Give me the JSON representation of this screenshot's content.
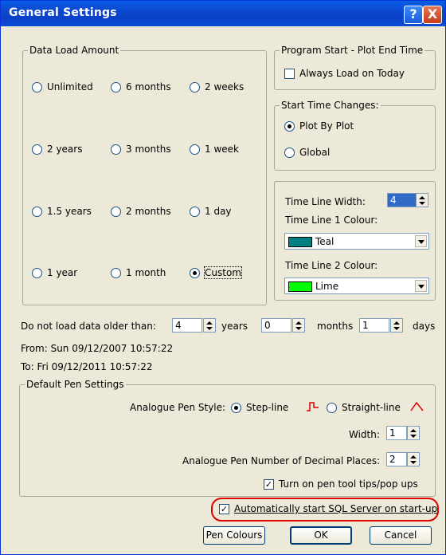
{
  "window": {
    "title": "General Settings",
    "help_label": "?",
    "close_label": "X"
  },
  "data_load": {
    "title": "Data Load Amount",
    "options": [
      "Unlimited",
      "6 months",
      "2 weeks",
      "2 years",
      "3 months",
      "1 week",
      "1.5 years",
      "2 months",
      "1 day",
      "1 year",
      "1 month",
      "Custom"
    ],
    "selected": "Custom"
  },
  "program_start": {
    "title": "Program Start - Plot End Time",
    "always_load_label": "Always Load on Today",
    "always_load_checked": false
  },
  "start_time": {
    "title": "Start Time Changes:",
    "options": [
      "Plot By Plot",
      "Global"
    ],
    "selected": "Plot By Plot"
  },
  "timeline": {
    "width_label": "Time Line Width:",
    "width_value": "4",
    "colour1_label": "Time Line 1 Colour:",
    "colour1_value": "Teal",
    "colour1_hex": "#008080",
    "colour2_label": "Time Line 2 Colour:",
    "colour2_value": "Lime",
    "colour2_hex": "#00ff00"
  },
  "older_than": {
    "label": "Do not load data older than:",
    "years": "4",
    "years_label": "years",
    "months": "0",
    "months_label": "months",
    "days": "1",
    "days_label": "days"
  },
  "range": {
    "from": "From:  Sun 09/12/2007 10:57:22",
    "to": "To:  Fri 09/12/2011 10:57:22"
  },
  "pen": {
    "title": "Default Pen Settings",
    "style_label": "Analogue Pen Style:",
    "step_label": "Step-line",
    "straight_label": "Straight-line",
    "selected": "Step-line",
    "width_label": "Width:",
    "width_value": "1",
    "decimals_label": "Analogue Pen Number of Decimal Places:",
    "decimals_value": "2",
    "tooltips_label": "Turn on pen tool tips/pop ups",
    "tooltips_checked": true
  },
  "sql": {
    "label": "Automatically start SQL Server on start-up",
    "checked": true,
    "highlight_color": "#e00000"
  },
  "buttons": {
    "pen_colours": "Pen Colours",
    "ok": "OK",
    "cancel": "Cancel"
  }
}
